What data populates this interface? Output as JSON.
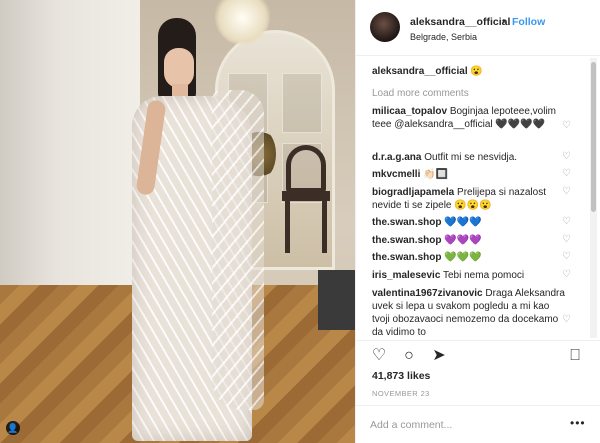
{
  "post": {
    "username": "aleksandra__official",
    "dot": "•",
    "follow_label": "Follow",
    "location": "Belgrade, Serbia",
    "caption_emoji": "😮",
    "load_more": "Load more comments",
    "likes": "41,873 likes",
    "date": "NOVEMBER 23",
    "add_comment_placeholder": "Add a comment...",
    "more_dots": "•••"
  },
  "comments": [
    {
      "user": "milicaa_topalov",
      "text": "Boginjaa lepoteee,volim teee @aleksandra__official 🖤🖤🖤🖤"
    },
    {
      "user": "d.r.a.g.ana",
      "text": "Outfit mi se nesvidja."
    },
    {
      "user": "mkvcmelli",
      "text": "👏🏻🔲"
    },
    {
      "user": "biogradljapamela",
      "text": "Prelijepa si nazalost nevide ti se zipele 😮😮😮"
    },
    {
      "user": "the.swan.shop",
      "text": "💙💙💙"
    },
    {
      "user": "the.swan.shop",
      "text": "💜💜💜"
    },
    {
      "user": "the.swan.shop",
      "text": "💚💚💚"
    },
    {
      "user": "iris_malesevic",
      "text": "Tebi nema pomoci"
    },
    {
      "user": "valentina1967zivanovic",
      "text": "Draga Aleksandra uvek si lepa u svakom pogledu a mi kao tvoji obozavaoci nemozemo da docekamo da vidimo to"
    }
  ],
  "icons": {
    "heart": "♡",
    "like": "♡",
    "comment": "○",
    "share": "➤",
    "save": "⎕",
    "tag": "👤"
  },
  "colors": {
    "follow_blue": "#3897f0",
    "muted": "#999999"
  }
}
